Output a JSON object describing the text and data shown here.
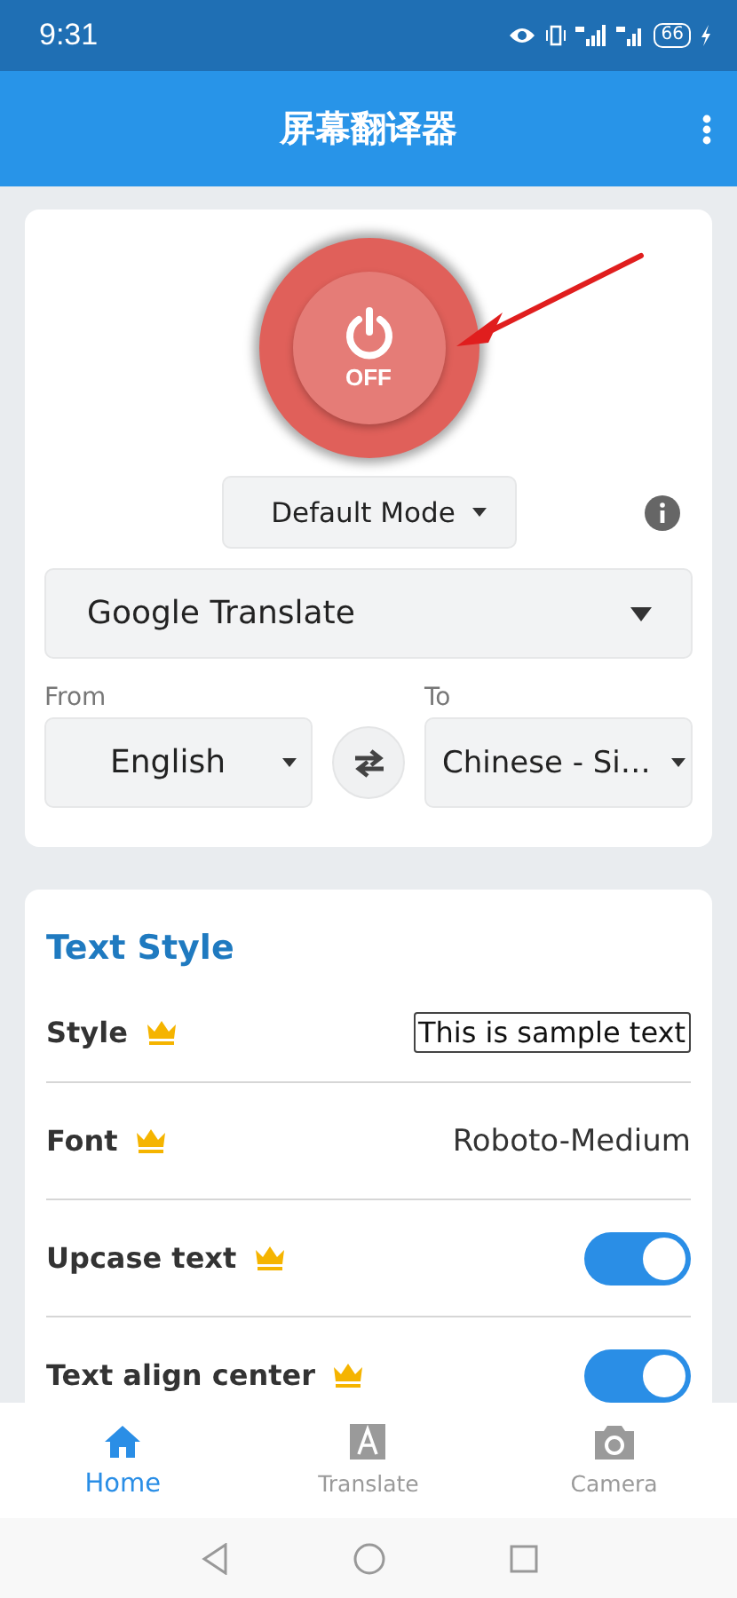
{
  "status_bar": {
    "time": "9:31",
    "battery": "66"
  },
  "app_bar": {
    "title": "屏幕翻译器"
  },
  "power": {
    "on": false,
    "label": "OFF"
  },
  "mode": {
    "value": "Default Mode"
  },
  "engine": {
    "value": "Google Translate"
  },
  "languages": {
    "from_label": "From",
    "from": "English",
    "to_label": "To",
    "to": "Chinese - Si…"
  },
  "text_style": {
    "title": "Text Style",
    "rows": [
      {
        "kind": "sample",
        "label": "Style",
        "premium": true,
        "value": "This is sample text"
      },
      {
        "kind": "value",
        "label": "Font",
        "premium": true,
        "value": "Roboto-Medium"
      },
      {
        "kind": "toggle",
        "label": "Upcase text",
        "premium": true,
        "on": true
      },
      {
        "kind": "toggle",
        "label": "Text align center",
        "premium": true,
        "on": true
      }
    ]
  },
  "bottom_nav": [
    {
      "label": "Home",
      "selected": true
    },
    {
      "label": "Translate",
      "selected": false
    },
    {
      "label": "Camera",
      "selected": false
    }
  ]
}
